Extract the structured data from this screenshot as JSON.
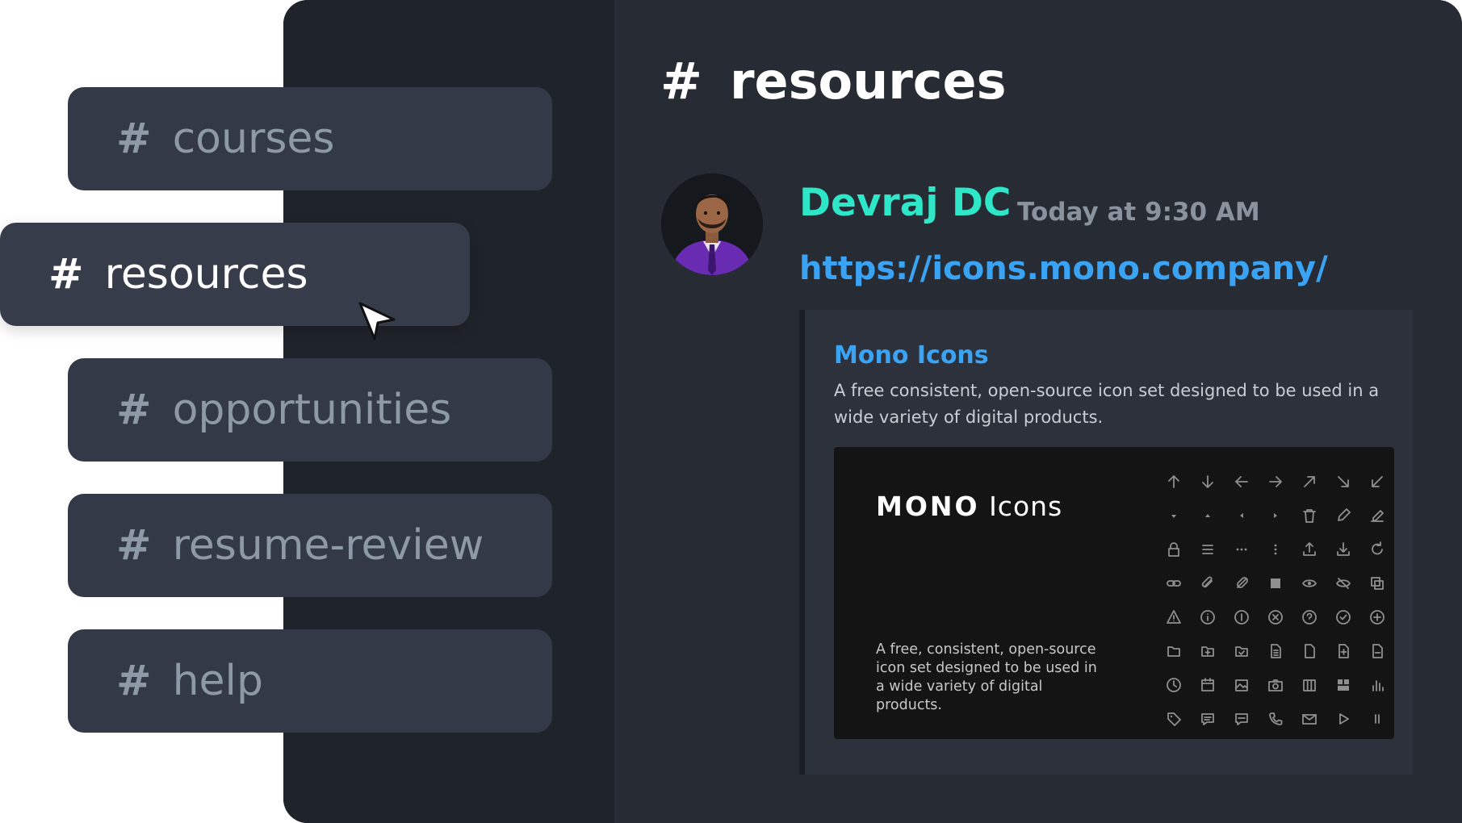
{
  "channels": [
    {
      "hash": "#",
      "label": "courses",
      "active": false
    },
    {
      "hash": "#",
      "label": "resources",
      "active": true
    },
    {
      "hash": "#",
      "label": "opportunities",
      "active": false
    },
    {
      "hash": "#",
      "label": "resume-review",
      "active": false
    },
    {
      "hash": "#",
      "label": "help",
      "active": false
    }
  ],
  "header": {
    "hash": "#",
    "title": "resources"
  },
  "message": {
    "author": "Devraj DC",
    "timestamp": "Today at 9:30 AM",
    "link": "https://icons.mono.company/",
    "author_color": "#2ee6c8",
    "link_color": "#3ba3f4"
  },
  "embed": {
    "title": "Mono Icons",
    "description": "A free consistent, open-source icon set designed to be used in a wide variety of digital products.",
    "image": {
      "brand_mark": "MONO",
      "brand_word": "Icons",
      "tagline": "A free, consistent, open-source icon set designed to be used in a wide variety of digital products.",
      "icon_names": [
        "arrow-up-icon",
        "arrow-down-icon",
        "arrow-left-icon",
        "arrow-right-icon",
        "arrow-up-right-icon",
        "arrow-down-right-icon",
        "arrow-down-left-icon",
        "caret-down-icon",
        "caret-up-icon",
        "caret-left-icon",
        "caret-right-icon",
        "delete-icon",
        "edit-icon",
        "edit-alt-icon",
        "lock-icon",
        "menu-icon",
        "options-horizontal-icon",
        "options-vertical-icon",
        "upload-icon",
        "download-icon",
        "refresh-icon",
        "link-icon",
        "attachment-icon",
        "clip-icon",
        "block-icon",
        "eye-icon",
        "eye-off-icon",
        "copy-icon",
        "warning-icon",
        "info-icon",
        "info-alt-icon",
        "close-circle-icon",
        "question-icon",
        "check-circle-icon",
        "add-circle-icon",
        "folder-icon",
        "folder-add-icon",
        "folder-check-icon",
        "document-icon",
        "file-icon",
        "file-add-icon",
        "file-remove-icon",
        "clock-icon",
        "calendar-icon",
        "image-icon",
        "camera-icon",
        "columns-icon",
        "layout-icon",
        "bar-chart-icon",
        "tag-icon",
        "comment-icon",
        "message-icon",
        "phone-icon",
        "email-icon",
        "play-icon",
        "pause-icon"
      ]
    }
  },
  "colors": {
    "window_bg": "#23272f",
    "pill_bg": "#333946",
    "pill_text": "#8d99a7"
  }
}
